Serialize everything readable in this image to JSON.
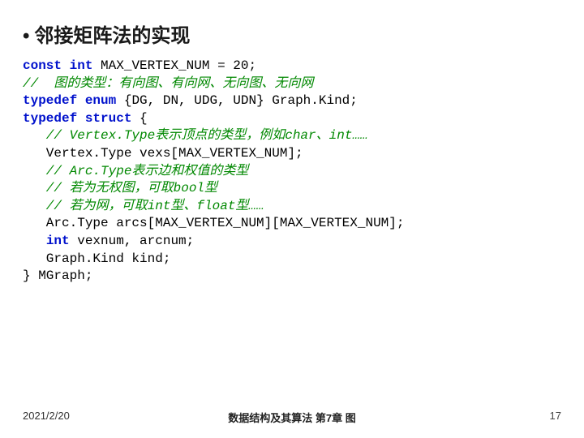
{
  "title": {
    "bullet": "•",
    "text": "邻接矩阵法的实现"
  },
  "code": {
    "l1_kw1": "const",
    "l1_kw2": "int",
    "l1_rest": " MAX_VERTEX_NUM = 20;",
    "l2": "//  图的类型：有向图、有向网、无向图、无向网",
    "l3_kw1": "typedef",
    "l3_kw2": "enum",
    "l3_rest": " {DG, DN, UDG, UDN} Graph.Kind;",
    "l4_kw1": "typedef",
    "l4_kw2": "struct",
    "l4_rest": " {",
    "l5": "   // Vertex.Type表示顶点的类型，例如char、int……",
    "l6": "   Vertex.Type vexs[MAX_VERTEX_NUM];",
    "l7": "   // Arc.Type表示边和权值的类型",
    "l8": "   // 若为无权图，可取bool型",
    "l9": "   // 若为网，可取int型、float型……",
    "l10": "   Arc.Type arcs[MAX_VERTEX_NUM][MAX_VERTEX_NUM];",
    "l11_a": "   ",
    "l11_kw": "int",
    "l11_b": " vexnum, arcnum;",
    "l12": "   Graph.Kind kind;",
    "l13": "} MGraph;"
  },
  "footer": {
    "date": "2021/2/20",
    "center": "数据结构及其算法  第7章  图",
    "page": "17"
  }
}
